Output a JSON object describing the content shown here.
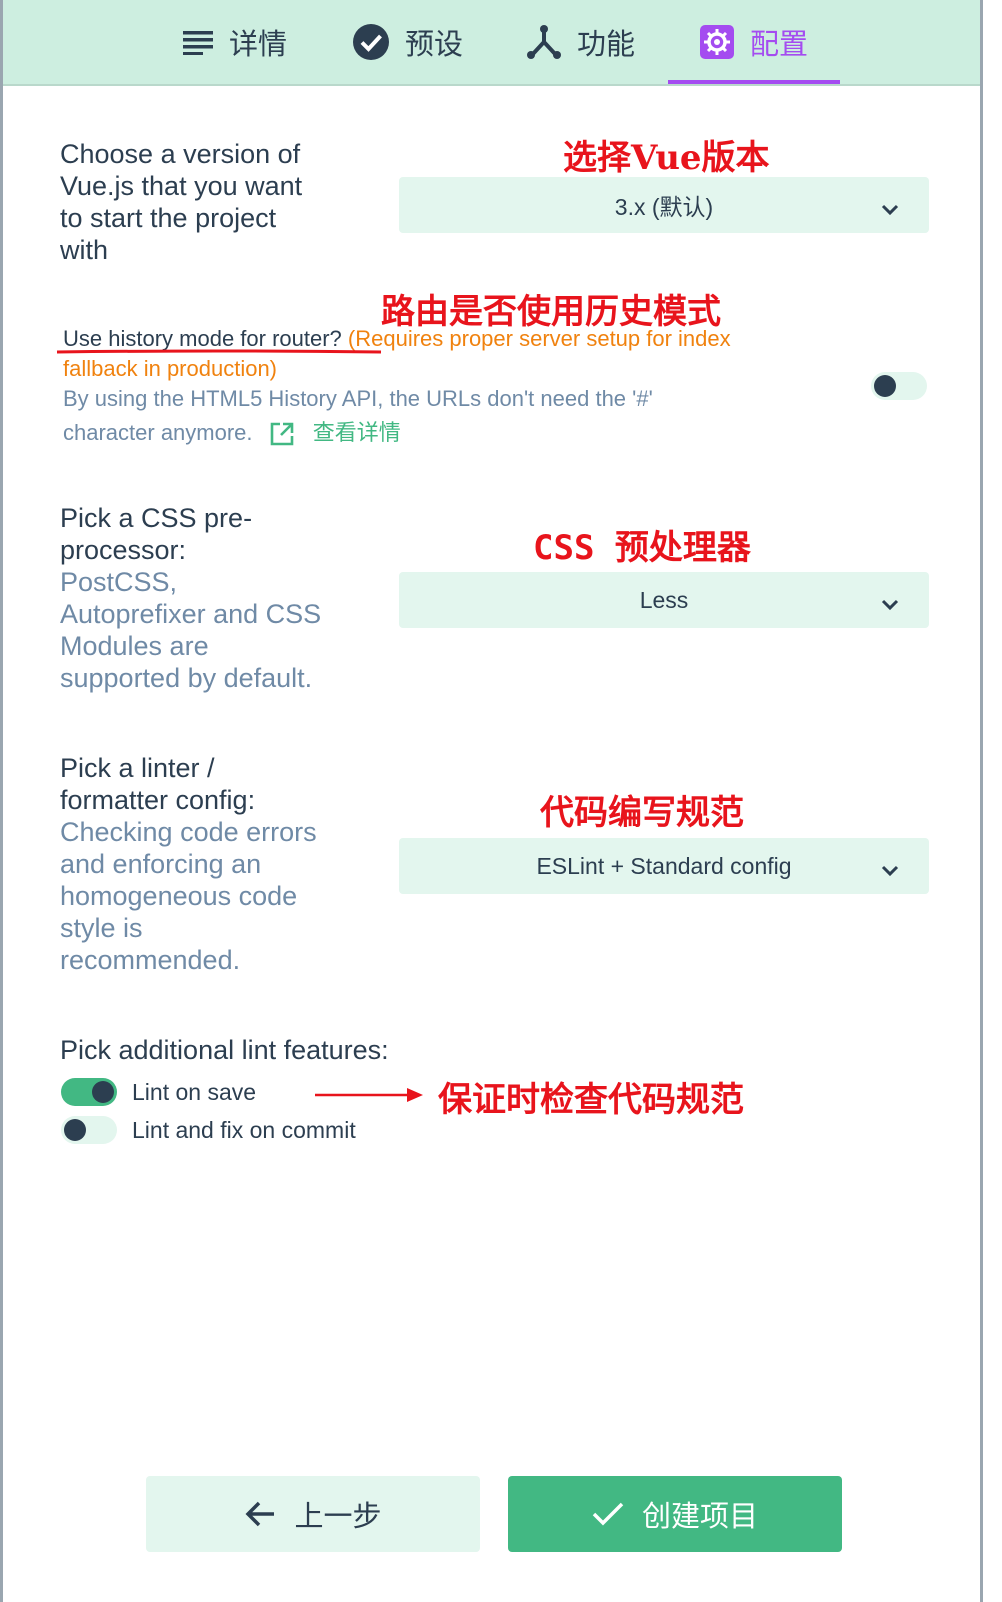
{
  "nav": {
    "tabs": [
      {
        "label": "详情",
        "icon": "list-icon"
      },
      {
        "label": "预设",
        "icon": "check-circle-icon"
      },
      {
        "label": "功能",
        "icon": "fork-icon"
      },
      {
        "label": "配置",
        "icon": "gear-icon"
      }
    ],
    "active_tab": "配置"
  },
  "vue_version": {
    "label": "Choose a version of Vue.js that you want to start the project with",
    "label_lines": [
      "Choose a version of",
      "Vue.js that you want",
      "to start the project",
      "with"
    ],
    "value": "3.x (默认)",
    "annotation": "选择Vue版本"
  },
  "router": {
    "annotation": "路由是否使用历史模式",
    "question": "Use history mode for router?",
    "warning": "(Requires proper server setup for index fallback in production)",
    "description": "By using the HTML5 History API, the URLs don't need the '#' character anymore.",
    "more_link": "查看详情",
    "enabled": false
  },
  "css": {
    "label_lines": [
      "Pick a CSS pre-",
      "processor:"
    ],
    "desc_lines": [
      "PostCSS,",
      "Autoprefixer and CSS",
      "Modules are",
      "supported by default."
    ],
    "value": "Less",
    "annotation": "CSS 预处理器"
  },
  "linter": {
    "label_lines": [
      "Pick a linter /",
      "formatter config:"
    ],
    "desc_lines": [
      "Checking code errors",
      "and enforcing an",
      "homogeneous code",
      "style is",
      "recommended."
    ],
    "value": "ESLint + Standard config",
    "annotation": "代码编写规范"
  },
  "lint_features": {
    "label": "Pick additional lint features:",
    "options": [
      {
        "label": "Lint on save",
        "enabled": true
      },
      {
        "label": "Lint and fix on commit",
        "enabled": false
      }
    ],
    "annotation": "保证时检查代码规范"
  },
  "footer": {
    "prev_label": "上一步",
    "create_label": "创建项目"
  },
  "colors": {
    "accent": "#42b883",
    "active_tab": "#a44cf0",
    "nav_bg": "#cdeee0",
    "annotation": "#e8141c",
    "warning": "#f0820f"
  }
}
